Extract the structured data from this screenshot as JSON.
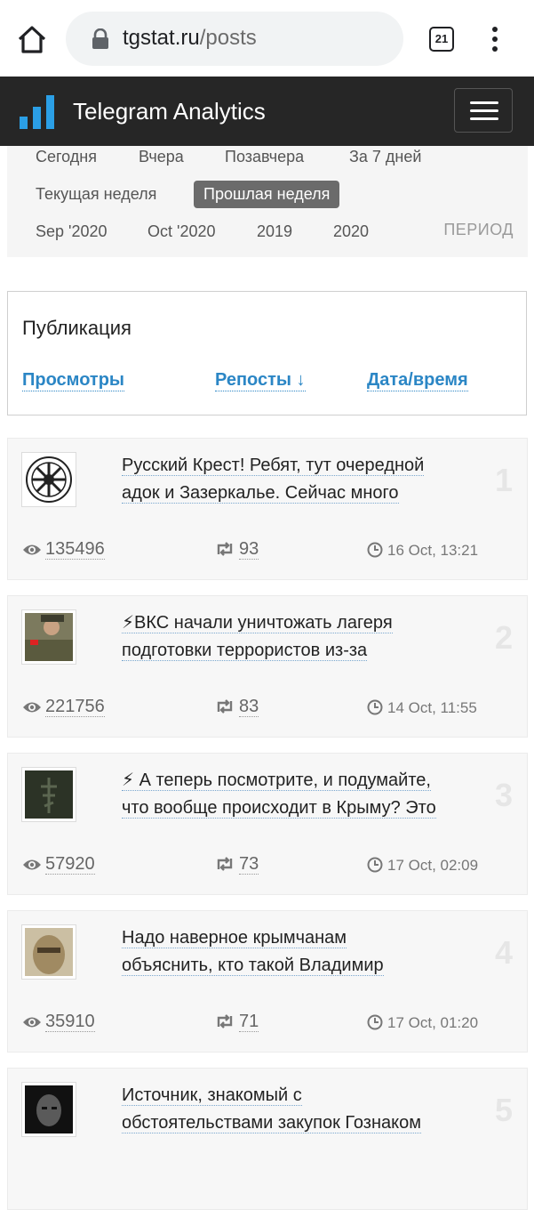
{
  "browser": {
    "url_domain": "tgstat.ru",
    "url_path": "/posts",
    "tab_count": "21"
  },
  "app": {
    "title": "Telegram Analytics"
  },
  "filters": {
    "row1": [
      "Сегодня",
      "Вчера",
      "Позавчера",
      "За 7 дней"
    ],
    "row2_current": "Текущая неделя",
    "row2_active": "Прошлая неделя",
    "row3": [
      "Sep '2020",
      "Oct '2020",
      "2019",
      "2020"
    ],
    "period": "ПЕРИОД"
  },
  "sort": {
    "title": "Публикация",
    "views": "Просмотры",
    "reposts": "Репосты ↓",
    "datetime": "Дата/время"
  },
  "posts": [
    {
      "rank": "1",
      "line1": "Русский Крест! Ребят, тут очередной",
      "line2": "адок и Зазеркалье. Сейчас много",
      "views": "135496",
      "reposts": "93",
      "date": "16 Oct, 13:21"
    },
    {
      "rank": "2",
      "line1": "⚡ВКС начали уничтожать лагеря",
      "line2": "подготовки террористов из-за",
      "views": "221756",
      "reposts": "83",
      "date": "14 Oct, 11:55"
    },
    {
      "rank": "3",
      "line1": "⚡ А теперь посмотрите, и подумайте,",
      "line2": "что вообще происходит в Крыму? Это",
      "views": "57920",
      "reposts": "73",
      "date": "17 Oct, 02:09"
    },
    {
      "rank": "4",
      "line1": "Надо наверное крымчанам",
      "line2": "объяснить, кто такой Владимир",
      "views": "35910",
      "reposts": "71",
      "date": "17 Oct, 01:20"
    },
    {
      "rank": "5",
      "line1": "Источник, знакомый с",
      "line2": "обстоятельствами закупок Гознаком",
      "views": "",
      "reposts": "",
      "date": ""
    }
  ],
  "colors": {
    "header_bg": "#262626",
    "logo_blue": "#2b9fe6",
    "link_blue": "#2b86c5"
  }
}
